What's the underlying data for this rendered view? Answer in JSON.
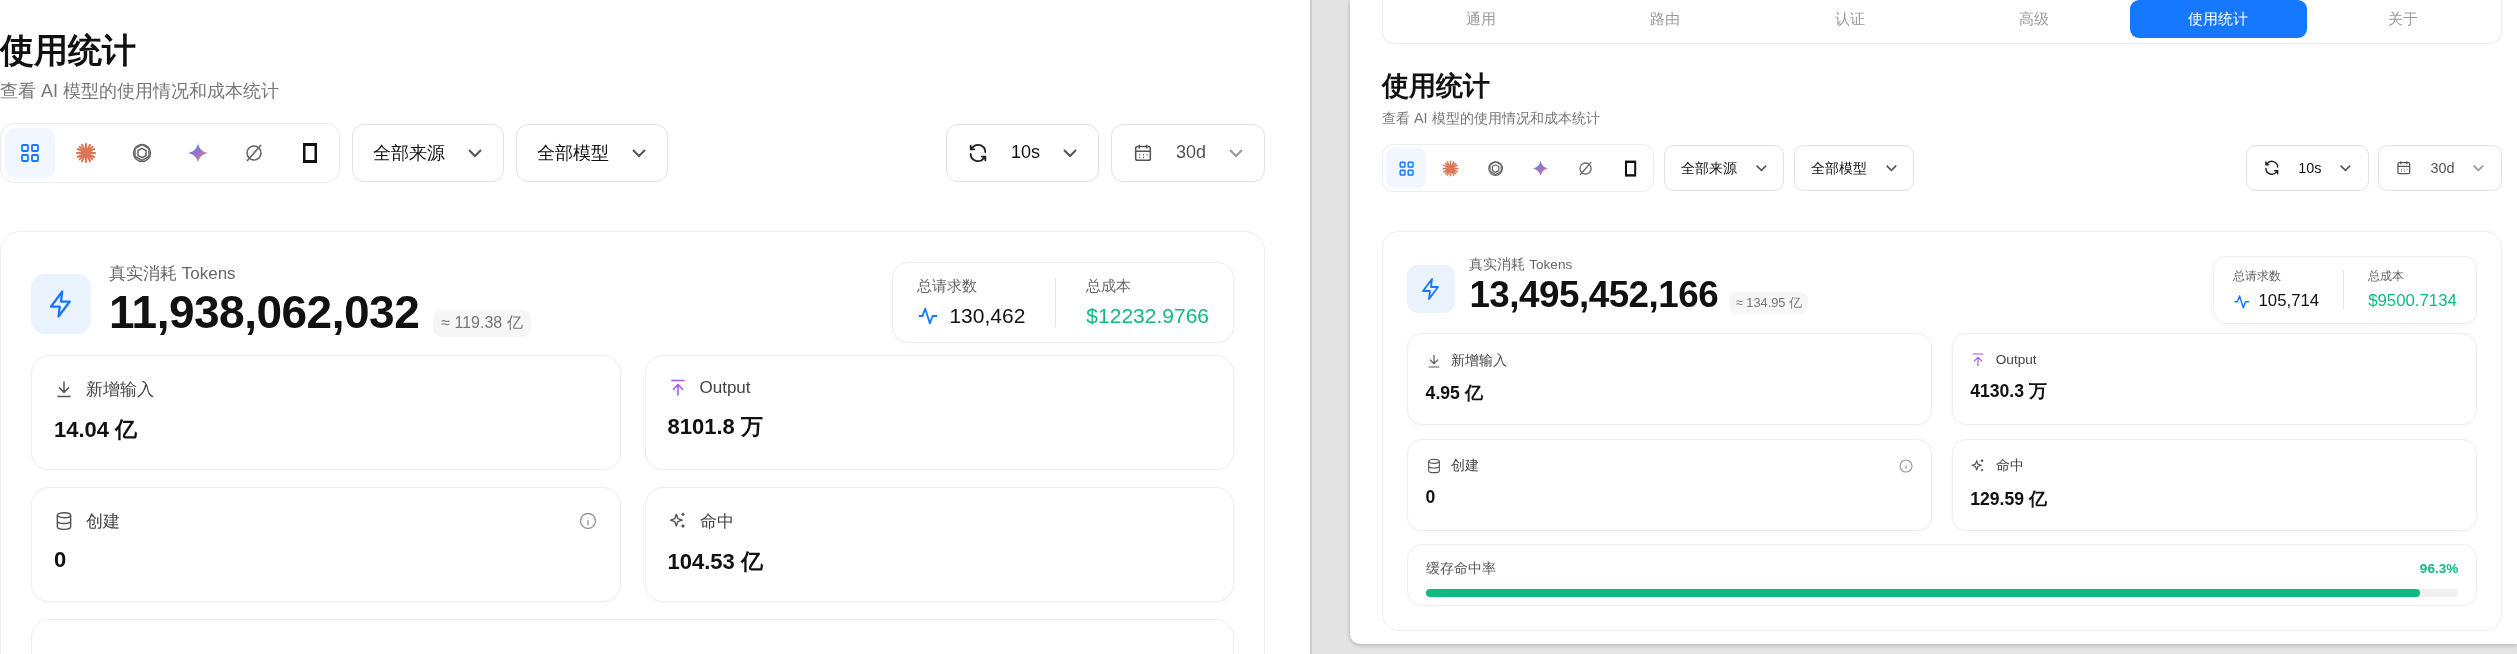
{
  "left_panel": {
    "page": {
      "title": "使用统计",
      "subtitle": "查看 AI 模型的使用情况和成本统计"
    },
    "source_filters": [
      {
        "kind": "all",
        "selected": true
      },
      {
        "kind": "asterisk",
        "selected": false
      },
      {
        "kind": "knot",
        "selected": false
      },
      {
        "kind": "sparkle",
        "selected": false
      },
      {
        "kind": "slashed",
        "selected": false
      },
      {
        "kind": "device",
        "selected": false
      }
    ],
    "toolbar": {
      "source_select": "全部来源",
      "model_select": "全部模型",
      "refresh_interval": "10s",
      "range": "30d"
    },
    "summary": {
      "label": "真实消耗 Tokens",
      "total": "11,938,062,032",
      "approx": "≈ 119.38 亿",
      "requests_label": "总请求数",
      "requests": "130,462",
      "cost_label": "总成本",
      "cost": "$12232.9766"
    },
    "metrics": [
      {
        "kind": "input",
        "label": "新增输入",
        "value": "14.04 亿",
        "info_icon": false
      },
      {
        "kind": "output",
        "label": "Output",
        "value": "8101.8 万",
        "info_icon": false
      },
      {
        "kind": "create",
        "label": "创建",
        "value": "0",
        "info_icon": true
      },
      {
        "kind": "hit",
        "label": "命中",
        "value": "104.53 亿",
        "info_icon": false
      }
    ]
  },
  "right_window": {
    "tabs": [
      {
        "label": "通用",
        "selected": false
      },
      {
        "label": "路由",
        "selected": false
      },
      {
        "label": "认证",
        "selected": false
      },
      {
        "label": "高级",
        "selected": false
      },
      {
        "label": "使用统计",
        "selected": true
      },
      {
        "label": "关于",
        "selected": false
      }
    ],
    "page": {
      "title": "使用统计",
      "subtitle": "查看 AI 模型的使用情况和成本统计"
    },
    "source_filters": [
      {
        "kind": "all",
        "selected": true
      },
      {
        "kind": "asterisk",
        "selected": false
      },
      {
        "kind": "knot",
        "selected": false
      },
      {
        "kind": "sparkle",
        "selected": false
      },
      {
        "kind": "slashed",
        "selected": false
      },
      {
        "kind": "device",
        "selected": false
      }
    ],
    "toolbar": {
      "source_select": "全部来源",
      "model_select": "全部模型",
      "refresh_interval": "10s",
      "range": "30d"
    },
    "summary": {
      "label": "真实消耗 Tokens",
      "total": "13,495,452,166",
      "approx": "≈ 134.95 亿",
      "requests_label": "总请求数",
      "requests": "105,714",
      "cost_label": "总成本",
      "cost": "$9500.7134"
    },
    "metrics": [
      {
        "kind": "input",
        "label": "新增输入",
        "value": "4.95 亿",
        "info_icon": false
      },
      {
        "kind": "output",
        "label": "Output",
        "value": "4130.3 万",
        "info_icon": false
      },
      {
        "kind": "create",
        "label": "创建",
        "value": "0",
        "info_icon": true
      },
      {
        "kind": "hit",
        "label": "命中",
        "value": "129.59 亿",
        "info_icon": false
      }
    ],
    "cache_hit_rate": {
      "label": "缓存命中率",
      "reading": "96.3%",
      "level": 0.963
    }
  }
}
